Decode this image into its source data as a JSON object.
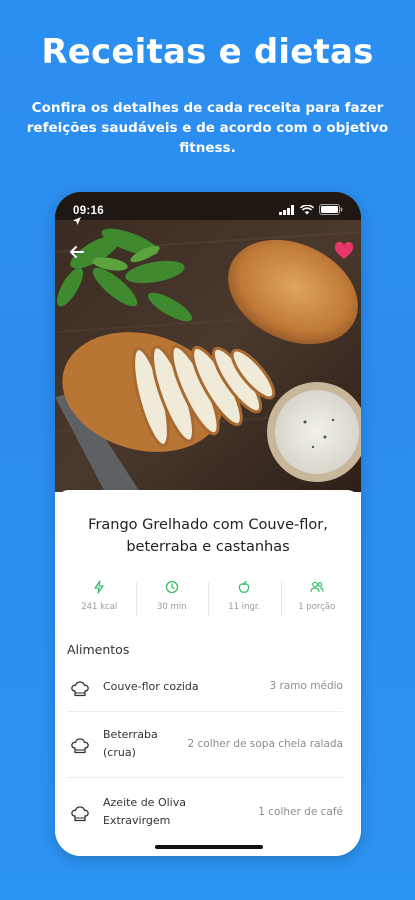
{
  "headline": "Receitas e dietas",
  "subtitle": "Confira os detalhes de cada receita para fazer refeições saudáveis e de acordo com o objetivo fitness.",
  "phone": {
    "status_time": "09:16",
    "recipe_title": "Frango Grelhado com Couve-flor, beterraba e castanhas",
    "stats": [
      {
        "icon": "lightning-icon",
        "label": "241 kcal"
      },
      {
        "icon": "clock-icon",
        "label": "30 min"
      },
      {
        "icon": "apple-icon",
        "label": "11 ingr."
      },
      {
        "icon": "people-icon",
        "label": "1 porção"
      }
    ],
    "section_title": "Alimentos",
    "foods": [
      {
        "name": "Couve-flor cozida",
        "quantity": "3 ramo médio"
      },
      {
        "name": "Beterraba (crua)",
        "quantity": "2 colher de sopa cheia ralada"
      },
      {
        "name": "Azeite de Oliva Extravirgem",
        "quantity": "1 colher de café"
      }
    ]
  },
  "colors": {
    "background": "#2b8ff0",
    "accent_green": "#3bbf6b",
    "heart": "#e8356a"
  }
}
